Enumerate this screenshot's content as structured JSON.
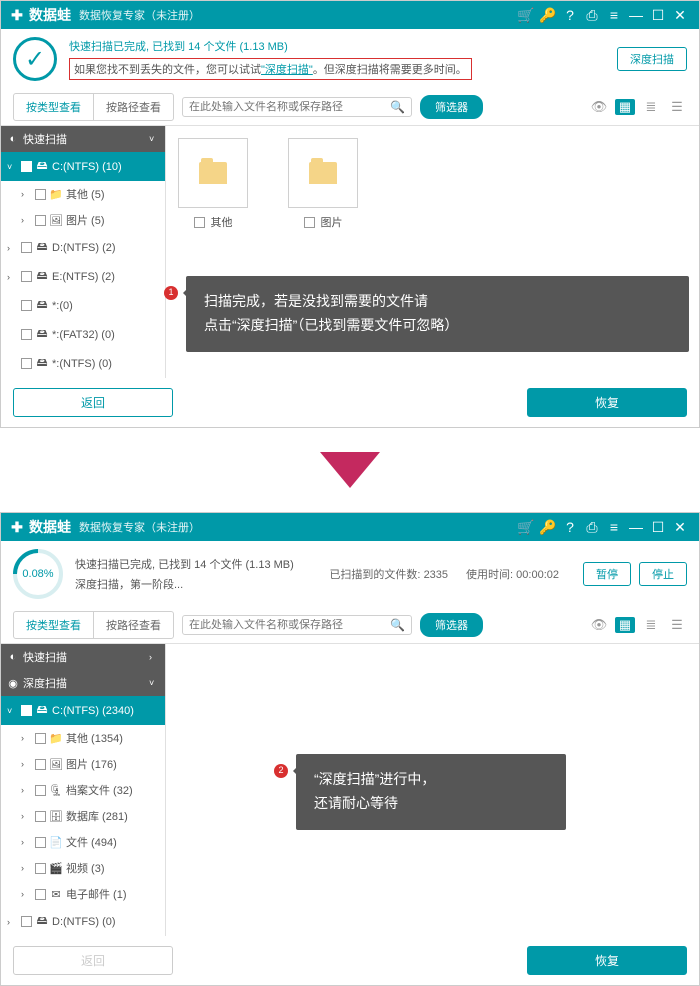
{
  "app_name": "数据蛙",
  "app_subtitle": "数据恢复专家（未注册）",
  "window1": {
    "header_line1": "快速扫描已完成, 已找到 14 个文件 (1.13 MB)",
    "header_line2_a": "如果您找不到丢失的文件，您可以试试",
    "header_line2_link": "\"深度扫描\"",
    "header_line2_b": "。但深度扫描将需要更多时间。",
    "deep_scan_btn": "深度扫描",
    "tab_type": "按类型查看",
    "tab_path": "按路径查看",
    "search_placeholder": "在此处输入文件名称或保存路径",
    "filter_btn": "筛选器",
    "tree": {
      "quick": "快速扫描",
      "c": "C:(NTFS) (10)",
      "other": "其他 (5)",
      "pic": "图片 (5)",
      "d": "D:(NTFS) (2)",
      "e": "E:(NTFS) (2)",
      "s1": "*:(0)",
      "s2": "*:(FAT32) (0)",
      "s3": "*:(NTFS) (0)"
    },
    "folders": {
      "other": "其他",
      "pic": "图片"
    },
    "tooltip_l1": "扫描完成，若是没找到需要的文件请",
    "tooltip_l2": "点击“深度扫描”（已找到需要文件可忽略）",
    "tooltip_num": "1",
    "back_btn": "返回",
    "recover_btn": "恢复"
  },
  "window2": {
    "pct": "0.08%",
    "header_l1": "快速扫描已完成, 已找到 14 个文件 (1.13 MB)",
    "header_l2": "深度扫描，第一阶段...",
    "stats_files_label": "已扫描到的文件数:",
    "stats_files": "2335",
    "stats_time_label": "使用时间:",
    "stats_time": "00:00:02",
    "pause_btn": "暂停",
    "stop_btn": "停止",
    "tab_type": "按类型查看",
    "tab_path": "按路径查看",
    "search_placeholder": "在此处输入文件名称或保存路径",
    "filter_btn": "筛选器",
    "tree": {
      "quick": "快速扫描",
      "deep": "深度扫描",
      "c": "C:(NTFS) (2340)",
      "other": "其他 (1354)",
      "pic": "图片 (176)",
      "archive": "档案文件 (32)",
      "db": "数据库 (281)",
      "doc": "文件 (494)",
      "video": "视频 (3)",
      "email": "电子邮件 (1)",
      "d": "D:(NTFS) (0)"
    },
    "tooltip_l1": "“深度扫描”进行中，",
    "tooltip_l2": "还请耐心等待",
    "tooltip_num": "2",
    "back_btn": "返回",
    "recover_btn": "恢复"
  }
}
